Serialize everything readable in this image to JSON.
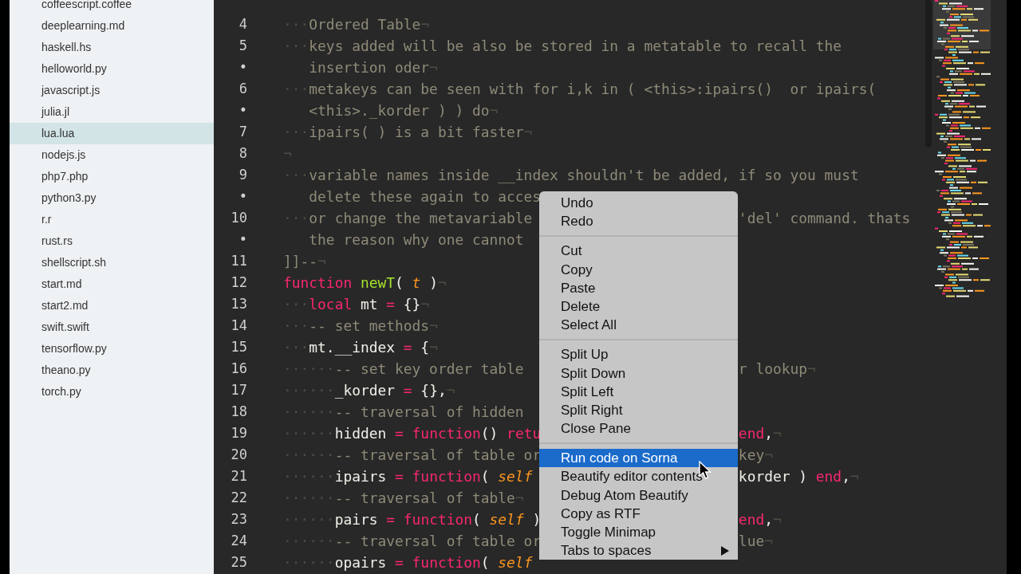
{
  "sidebar": {
    "files": [
      {
        "name": "coffeescript.coffee",
        "selected": false
      },
      {
        "name": "deeplearning.md",
        "selected": false
      },
      {
        "name": "haskell.hs",
        "selected": false
      },
      {
        "name": "helloworld.py",
        "selected": false
      },
      {
        "name": "javascript.js",
        "selected": false
      },
      {
        "name": "julia.jl",
        "selected": false
      },
      {
        "name": "lua.lua",
        "selected": true
      },
      {
        "name": "nodejs.js",
        "selected": false
      },
      {
        "name": "php7.php",
        "selected": false
      },
      {
        "name": "python3.py",
        "selected": false
      },
      {
        "name": "r.r",
        "selected": false
      },
      {
        "name": "rust.rs",
        "selected": false
      },
      {
        "name": "shellscript.sh",
        "selected": false
      },
      {
        "name": "start.md",
        "selected": false
      },
      {
        "name": "start2.md",
        "selected": false
      },
      {
        "name": "swift.swift",
        "selected": false
      },
      {
        "name": "tensorflow.py",
        "selected": false
      },
      {
        "name": "theano.py",
        "selected": false
      },
      {
        "name": "torch.py",
        "selected": false
      }
    ]
  },
  "editor": {
    "lines": [
      {
        "number": "4",
        "left": [
          {
            "text": "···",
            "kind": "ws"
          },
          {
            "text": "Ordered Table",
            "kind": "cm"
          },
          {
            "text": "¬",
            "kind": "ws"
          }
        ]
      },
      {
        "number": "5",
        "left": [
          {
            "text": "···",
            "kind": "ws"
          },
          {
            "text": "keys added will be also be stored in a metatable to recall the",
            "kind": "cm"
          }
        ]
      },
      {
        "number": "•",
        "left": [
          {
            "text": "   insertion oder",
            "kind": "cm"
          },
          {
            "text": "¬",
            "kind": "ws"
          }
        ]
      },
      {
        "number": "6",
        "left": [
          {
            "text": "···",
            "kind": "ws"
          },
          {
            "text": "metakeys can be seen with for i,k in ( <this>:ipairs()  or ipairs(",
            "kind": "cm"
          }
        ]
      },
      {
        "number": "•",
        "left": [
          {
            "text": "   <this>._korder ) ) do",
            "kind": "cm"
          },
          {
            "text": "¬",
            "kind": "ws"
          }
        ]
      },
      {
        "number": "7",
        "left": [
          {
            "text": "···",
            "kind": "ws"
          },
          {
            "text": "ipairs( ) is a bit faster",
            "kind": "cm"
          },
          {
            "text": "¬",
            "kind": "ws"
          }
        ]
      },
      {
        "number": "8",
        "left": [
          {
            "text": "¬",
            "kind": "ws"
          }
        ]
      },
      {
        "number": "9",
        "left": [
          {
            "text": "···",
            "kind": "ws"
          },
          {
            "text": "variable names inside __index shouldn't be added, if so you must",
            "kind": "cm"
          }
        ]
      },
      {
        "number": "•",
        "left": [
          {
            "text": "   delete these again to acces",
            "kind": "cm"
          }
        ]
      },
      {
        "number": "10",
        "left": [
          {
            "text": "···",
            "kind": "ws"
          },
          {
            "text": "or change the metavariable",
            "kind": "cm"
          }
        ],
        "right": [
          {
            "text": "'del' command. thats",
            "kind": "cm"
          }
        ]
      },
      {
        "number": "•",
        "left": [
          {
            "text": "   the reason why one cannot",
            "kind": "cm"
          }
        ]
      },
      {
        "number": "11",
        "left": [
          {
            "text": "]]--",
            "kind": "cm"
          },
          {
            "text": "¬",
            "kind": "ws"
          }
        ]
      },
      {
        "number": "12",
        "left": [
          {
            "text": "function",
            "kind": "kw"
          },
          {
            "text": " newT",
            "kind": "fn"
          },
          {
            "text": "( ",
            "kind": "tx"
          },
          {
            "text": "t",
            "kind": "param"
          },
          {
            "text": " )",
            "kind": "tx"
          },
          {
            "text": "¬",
            "kind": "ws"
          }
        ]
      },
      {
        "number": "13",
        "left": [
          {
            "text": "···",
            "kind": "ws"
          },
          {
            "text": "local",
            "kind": "kw"
          },
          {
            "text": " mt ",
            "kind": "tx"
          },
          {
            "text": "=",
            "kind": "kw"
          },
          {
            "text": " {}",
            "kind": "tx"
          },
          {
            "text": "¬",
            "kind": "ws"
          }
        ]
      },
      {
        "number": "14",
        "left": [
          {
            "text": "···",
            "kind": "ws"
          },
          {
            "text": "-- set methods",
            "kind": "cm"
          },
          {
            "text": "¬",
            "kind": "ws"
          }
        ]
      },
      {
        "number": "15",
        "left": [
          {
            "text": "···",
            "kind": "ws"
          },
          {
            "text": "mt.__index ",
            "kind": "tx"
          },
          {
            "text": "=",
            "kind": "kw"
          },
          {
            "text": " {",
            "kind": "tx"
          },
          {
            "text": "¬",
            "kind": "ws"
          }
        ]
      },
      {
        "number": "16",
        "left": [
          {
            "text": "······",
            "kind": "ws"
          },
          {
            "text": "-- set key order table",
            "kind": "cm"
          }
        ],
        "right": [
          {
            "text": "r lookup",
            "kind": "cm"
          },
          {
            "text": "¬",
            "kind": "ws"
          }
        ]
      },
      {
        "number": "17",
        "left": [
          {
            "text": "······",
            "kind": "ws"
          },
          {
            "text": "_korder ",
            "kind": "tx"
          },
          {
            "text": "=",
            "kind": "kw"
          },
          {
            "text": " {},",
            "kind": "tx"
          },
          {
            "text": "¬",
            "kind": "ws"
          }
        ]
      },
      {
        "number": "18",
        "left": [
          {
            "text": "······",
            "kind": "ws"
          },
          {
            "text": "-- traversal of hidden",
            "kind": "cm"
          }
        ]
      },
      {
        "number": "19",
        "left": [
          {
            "text": "······",
            "kind": "ws"
          },
          {
            "text": "hidden ",
            "kind": "tx"
          },
          {
            "text": "=",
            "kind": "kw"
          },
          {
            "text": " function",
            "kind": "kw"
          },
          {
            "text": "() ",
            "kind": "tx"
          },
          {
            "text": "retu",
            "kind": "kw"
          }
        ],
        "right": [
          {
            "text": "end",
            "kind": "kw"
          },
          {
            "text": ",",
            "kind": "tx"
          },
          {
            "text": "¬",
            "kind": "ws"
          }
        ]
      },
      {
        "number": "20",
        "left": [
          {
            "text": "······",
            "kind": "ws"
          },
          {
            "text": "-- traversal of table or",
            "kind": "cm"
          }
        ],
        "right": [
          {
            "text": "key",
            "kind": "cm"
          },
          {
            "text": "¬",
            "kind": "ws"
          }
        ]
      },
      {
        "number": "21",
        "left": [
          {
            "text": "······",
            "kind": "ws"
          },
          {
            "text": "ipairs ",
            "kind": "tx"
          },
          {
            "text": "=",
            "kind": "kw"
          },
          {
            "text": " function",
            "kind": "kw"
          },
          {
            "text": "( ",
            "kind": "tx"
          },
          {
            "text": "self",
            "kind": "param"
          }
        ],
        "right": [
          {
            "text": "korder ) ",
            "kind": "tx"
          },
          {
            "text": "end",
            "kind": "kw"
          },
          {
            "text": ",",
            "kind": "tx"
          },
          {
            "text": "¬",
            "kind": "ws"
          }
        ]
      },
      {
        "number": "22",
        "left": [
          {
            "text": "······",
            "kind": "ws"
          },
          {
            "text": "-- traversal of table",
            "kind": "cm"
          },
          {
            "text": "¬",
            "kind": "ws"
          }
        ]
      },
      {
        "number": "23",
        "left": [
          {
            "text": "······",
            "kind": "ws"
          },
          {
            "text": "pairs ",
            "kind": "tx"
          },
          {
            "text": "=",
            "kind": "kw"
          },
          {
            "text": " function",
            "kind": "kw"
          },
          {
            "text": "( ",
            "kind": "tx"
          },
          {
            "text": "self",
            "kind": "param"
          },
          {
            "text": " )",
            "kind": "tx"
          }
        ],
        "right": [
          {
            "text": "end",
            "kind": "kw"
          },
          {
            "text": ",",
            "kind": "tx"
          },
          {
            "text": "¬",
            "kind": "ws"
          }
        ]
      },
      {
        "number": "24",
        "left": [
          {
            "text": "······",
            "kind": "ws"
          },
          {
            "text": "-- traversal of table or",
            "kind": "cm"
          }
        ],
        "right": [
          {
            "text": "lue",
            "kind": "cm"
          },
          {
            "text": "¬",
            "kind": "ws"
          }
        ]
      },
      {
        "number": "25",
        "left": [
          {
            "text": "······",
            "kind": "ws"
          },
          {
            "text": "opairs ",
            "kind": "tx"
          },
          {
            "text": "=",
            "kind": "kw"
          },
          {
            "text": " function",
            "kind": "kw"
          },
          {
            "text": "( ",
            "kind": "tx"
          },
          {
            "text": "self",
            "kind": "param"
          }
        ]
      }
    ]
  },
  "context_menu": {
    "groups": [
      {
        "items": [
          {
            "label": "Undo",
            "selected": false
          },
          {
            "label": "Redo",
            "selected": false
          }
        ]
      },
      {
        "items": [
          {
            "label": "Cut",
            "selected": false
          },
          {
            "label": "Copy",
            "selected": false
          },
          {
            "label": "Paste",
            "selected": false
          },
          {
            "label": "Delete",
            "selected": false
          },
          {
            "label": "Select All",
            "selected": false
          }
        ]
      },
      {
        "items": [
          {
            "label": "Split Up",
            "selected": false
          },
          {
            "label": "Split Down",
            "selected": false
          },
          {
            "label": "Split Left",
            "selected": false
          },
          {
            "label": "Split Right",
            "selected": false
          },
          {
            "label": "Close Pane",
            "selected": false
          }
        ]
      },
      {
        "items": [
          {
            "label": "Run code on Sorna",
            "selected": true
          },
          {
            "label": "Beautify editor contents",
            "selected": false
          },
          {
            "label": "Debug Atom Beautify",
            "selected": false
          },
          {
            "label": "Copy as RTF",
            "selected": false
          },
          {
            "label": "Toggle Minimap",
            "selected": false
          },
          {
            "label": "Tabs to spaces",
            "selected": false,
            "submenu": true
          }
        ]
      }
    ]
  }
}
